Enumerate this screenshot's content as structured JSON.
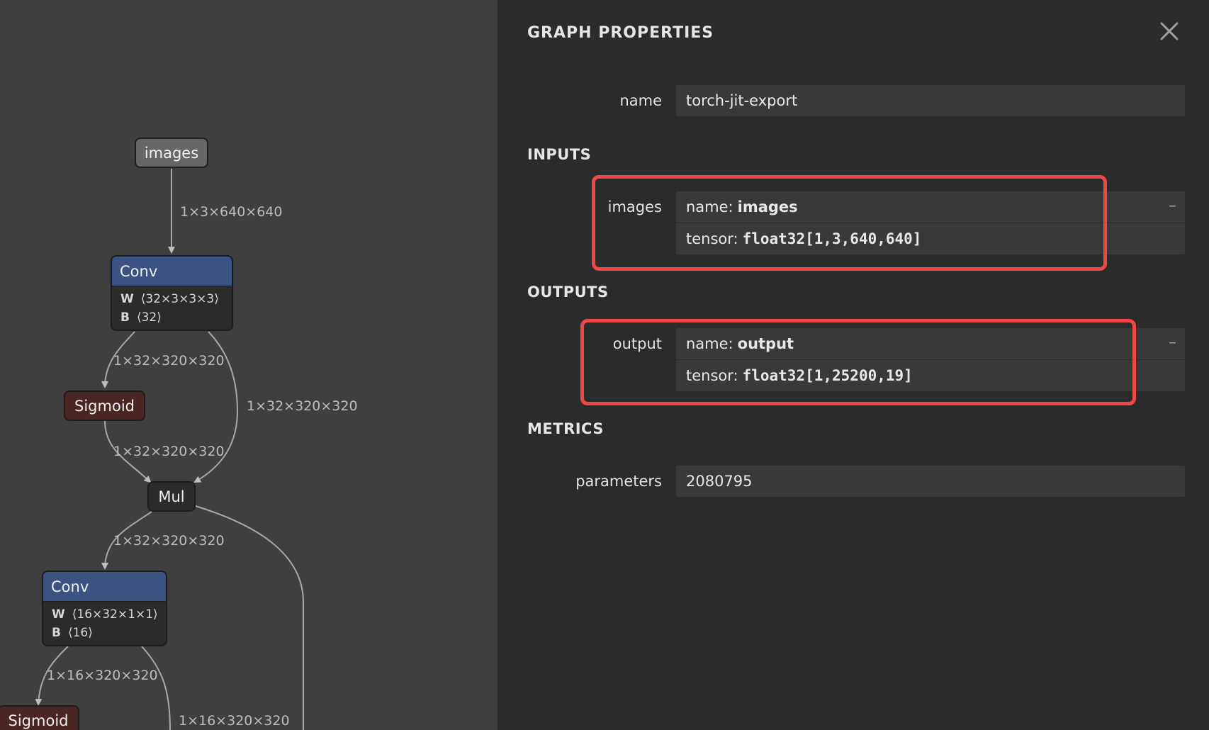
{
  "graph": {
    "nodes": {
      "images_input": "images",
      "conv1": {
        "title": "Conv",
        "w_key": "W",
        "w_val": "⟨32×3×3×3⟩",
        "b_key": "B",
        "b_val": "⟨32⟩"
      },
      "sigmoid1": "Sigmoid",
      "mul1": "Mul",
      "conv2": {
        "title": "Conv",
        "w_key": "W",
        "w_val": "⟨16×32×1×1⟩",
        "b_key": "B",
        "b_val": "⟨16⟩"
      },
      "sigmoid2": "Sigmoid"
    },
    "edges": {
      "e1": "1×3×640×640",
      "e2": "1×32×320×320",
      "e3": "1×32×320×320",
      "e4": "1×32×320×320",
      "e5": "1×32×320×320",
      "e6": "1×16×320×320",
      "e7": "1×16×320×320"
    }
  },
  "panel": {
    "title": "GRAPH PROPERTIES",
    "name_label": "name",
    "name_value": "torch-jit-export",
    "inputs_header": "INPUTS",
    "input": {
      "label": "images",
      "name_prefix": "name:",
      "name": "images",
      "tensor_prefix": "tensor:",
      "tensor": "float32[1,3,640,640]"
    },
    "outputs_header": "OUTPUTS",
    "output": {
      "label": "output",
      "name_prefix": "name:",
      "name": "output",
      "tensor_prefix": "tensor:",
      "tensor": "float32[1,25200,19]"
    },
    "metrics_header": "METRICS",
    "parameters_label": "parameters",
    "parameters_value": "2080795",
    "collapse_symbol": "–",
    "highlight_color": "#ef4747"
  }
}
